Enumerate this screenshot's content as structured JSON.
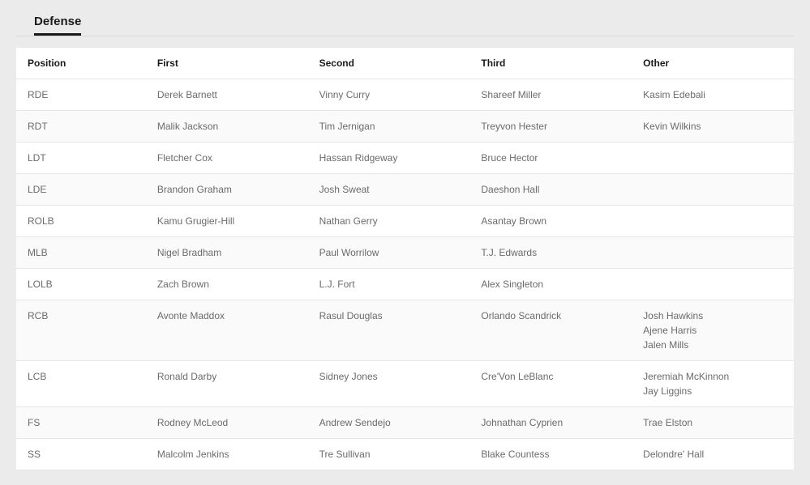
{
  "section": {
    "title": "Defense"
  },
  "columns": {
    "position": "Position",
    "first": "First",
    "second": "Second",
    "third": "Third",
    "other": "Other"
  },
  "rows": [
    {
      "position": "RDE",
      "first": "Derek Barnett",
      "second": "Vinny Curry",
      "third": "Shareef Miller",
      "other": [
        "Kasim Edebali"
      ]
    },
    {
      "position": "RDT",
      "first": "Malik Jackson",
      "second": "Tim Jernigan",
      "third": "Treyvon Hester",
      "other": [
        "Kevin Wilkins"
      ]
    },
    {
      "position": "LDT",
      "first": "Fletcher Cox",
      "second": "Hassan Ridgeway",
      "third": "Bruce Hector",
      "other": []
    },
    {
      "position": "LDE",
      "first": "Brandon Graham",
      "second": "Josh Sweat",
      "third": "Daeshon Hall",
      "other": []
    },
    {
      "position": "ROLB",
      "first": "Kamu Grugier-Hill",
      "second": "Nathan Gerry",
      "third": "Asantay Brown",
      "other": []
    },
    {
      "position": "MLB",
      "first": "Nigel Bradham",
      "second": "Paul Worrilow",
      "third": "T.J. Edwards",
      "other": []
    },
    {
      "position": "LOLB",
      "first": "Zach Brown",
      "second": "L.J. Fort",
      "third": "Alex Singleton",
      "other": []
    },
    {
      "position": "RCB",
      "first": "Avonte Maddox",
      "second": "Rasul Douglas",
      "third": "Orlando Scandrick",
      "other": [
        "Josh Hawkins",
        "Ajene Harris",
        "Jalen Mills"
      ]
    },
    {
      "position": "LCB",
      "first": "Ronald Darby",
      "second": "Sidney Jones",
      "third": "Cre'Von LeBlanc",
      "other": [
        "Jeremiah McKinnon",
        "Jay Liggins"
      ]
    },
    {
      "position": "FS",
      "first": "Rodney McLeod",
      "second": "Andrew Sendejo",
      "third": "Johnathan Cyprien",
      "other": [
        "Trae Elston"
      ]
    },
    {
      "position": "SS",
      "first": "Malcolm Jenkins",
      "second": "Tre Sullivan",
      "third": "Blake Countess",
      "other": [
        "Delondre' Hall"
      ]
    }
  ]
}
